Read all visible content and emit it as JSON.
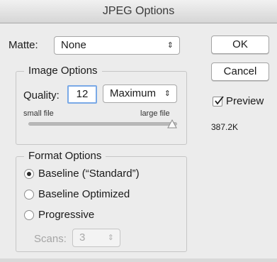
{
  "window": {
    "title": "JPEG Options"
  },
  "matte": {
    "label": "Matte:",
    "value": "None"
  },
  "buttons": {
    "ok": "OK",
    "cancel": "Cancel"
  },
  "preview": {
    "label": "Preview",
    "checked": true,
    "file_size": "387.2K"
  },
  "image_options": {
    "title": "Image Options",
    "quality_label": "Quality:",
    "quality_value": "12",
    "quality_preset": "Maximum",
    "small_label": "small file",
    "large_label": "large file",
    "slider_fraction": 1.0
  },
  "format_options": {
    "title": "Format Options",
    "options": [
      {
        "label": "Baseline (“Standard”)",
        "selected": true
      },
      {
        "label": "Baseline Optimized",
        "selected": false
      },
      {
        "label": "Progressive",
        "selected": false
      }
    ],
    "scans_label": "Scans:",
    "scans_value": "3"
  },
  "colors": {
    "accent_border": "#7aa9e6",
    "window_bg": "#ececec"
  },
  "icons": {
    "select_arrows": "updown-arrows-icon",
    "check": "checkmark-icon",
    "slider_knob": "triangle-knob-icon"
  }
}
